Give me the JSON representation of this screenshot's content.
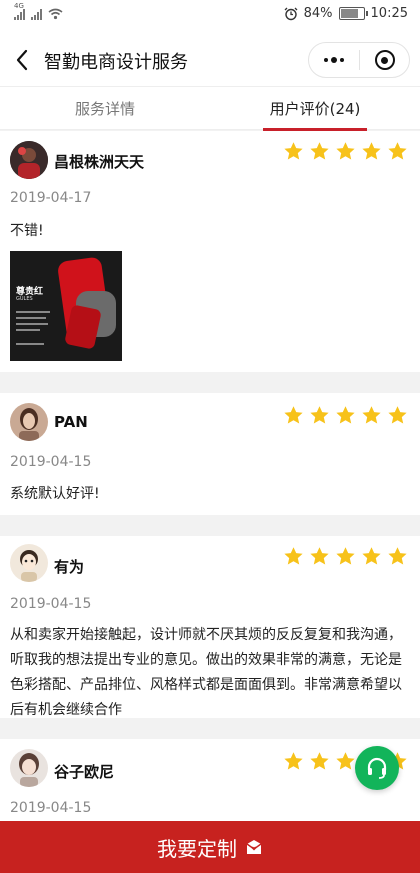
{
  "status_bar": {
    "network_label": "4G",
    "battery": "84%",
    "battery_level": 0.84,
    "time": "10:25"
  },
  "nav": {
    "title": "智勤电商设计服务"
  },
  "tabs": [
    {
      "label": "服务详情",
      "active": false
    },
    {
      "label": "用户评价(24)",
      "active": true
    }
  ],
  "reviews": [
    {
      "name": "昌根株洲天天",
      "rating": 5,
      "date": "2019-04-17",
      "text": "不错!",
      "image": {
        "headline": "尊贵红",
        "subhead": "GULES"
      }
    },
    {
      "name": "PAN",
      "rating": 5,
      "date": "2019-04-15",
      "text": "系统默认好评!"
    },
    {
      "name": "有为",
      "rating": 5,
      "date": "2019-04-15",
      "text": "从和卖家开始接触起，设计师就不厌其烦的反反复复和我沟通，听取我的想法提出专业的意见。做出的效果非常的满意，无论是色彩搭配、产品排位、风格样式都是面面俱到。非常满意希望以后有机会继续合作"
    },
    {
      "name": "谷子欧尼",
      "rating": 5,
      "date": "2019-04-15"
    }
  ],
  "bottom_button": {
    "label": "我要定制"
  },
  "colors": {
    "accent": "#c7221f",
    "star": "#f7c21a",
    "fab": "#12b45a"
  },
  "icons": {
    "back": "chevron-left-icon",
    "more": "more-dots-icon",
    "close": "target-close-icon",
    "star": "star-icon",
    "headset": "headset-icon",
    "message": "mail-heart-icon"
  }
}
